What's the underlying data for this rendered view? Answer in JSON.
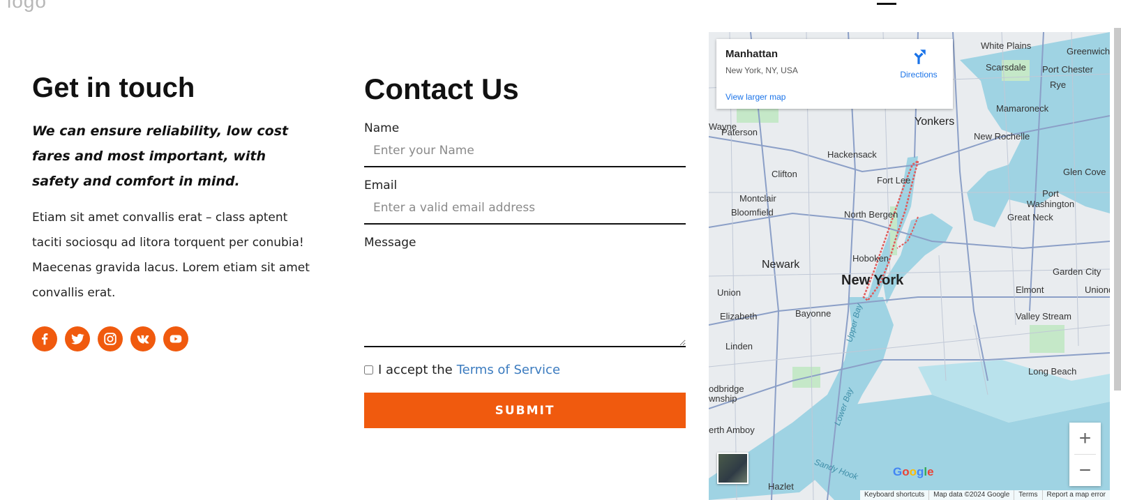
{
  "header": {
    "logo_text": "logo"
  },
  "get_in_touch": {
    "title": "Get in touch",
    "tagline": "We can ensure reliability, low cost fares and most important, with safety and comfort in mind.",
    "body": "Etiam sit amet convallis erat – class aptent taciti sociosqu ad litora torquent per conubia! Maecenas gravida lacus. Lorem etiam sit amet convallis erat.",
    "social": [
      "facebook",
      "twitter",
      "instagram",
      "vk",
      "youtube"
    ]
  },
  "contact_form": {
    "title": "Contact Us",
    "name_label": "Name",
    "name_placeholder": "Enter your Name",
    "email_label": "Email",
    "email_placeholder": "Enter a valid email address",
    "message_label": "Message",
    "terms_text": "I accept the",
    "terms_link": "Terms of Service",
    "submit_label": "SUBMIT"
  },
  "map": {
    "info_title": "Manhattan",
    "info_subtitle": "New York, NY, USA",
    "directions_label": "Directions",
    "view_larger": "View larger map",
    "zoom_in": "+",
    "zoom_out": "−",
    "google": "Google",
    "attribution": [
      "Keyboard shortcuts",
      "Map data ©2024 Google",
      "Terms",
      "Report a map error"
    ],
    "labels": {
      "white_plains": "White Plains",
      "greenwich": "Greenwich",
      "scarsdale": "Scarsdale",
      "port_chester": "Port Chester",
      "rye": "Rye",
      "mamaroneck": "Mamaroneck",
      "wayne": "Wayne",
      "paterson": "Paterson",
      "yonkers": "Yonkers",
      "new_rochelle": "New Rochelle",
      "hackensack": "Hackensack",
      "clifton": "Clifton",
      "fort_lee": "Fort Lee",
      "glen_cove": "Glen Cove",
      "montclair": "Montclair",
      "bloomfield": "Bloomfield",
      "north_bergen": "North Bergen",
      "port_washington": "Port Washington",
      "great_neck": "Great Neck",
      "newark": "Newark",
      "hoboken": "Hoboken",
      "new_york": "New York",
      "garden_city": "Garden City",
      "union": "Union",
      "elmont": "Elmont",
      "uniondale": "Uniond",
      "elizabeth": "Elizabeth",
      "bayonne": "Bayonne",
      "valley_stream": "Valley Stream",
      "linden": "Linden",
      "long_beach": "Long Beach",
      "woodbridge": "odbridge",
      "township": "wnship",
      "perth_amboy": "erth Amboy",
      "upper_bay": "Upper Bay",
      "lower_bay": "Lower Bay",
      "sandy_hook": "Sandy Hook",
      "hazlet": "Hazlet"
    }
  }
}
